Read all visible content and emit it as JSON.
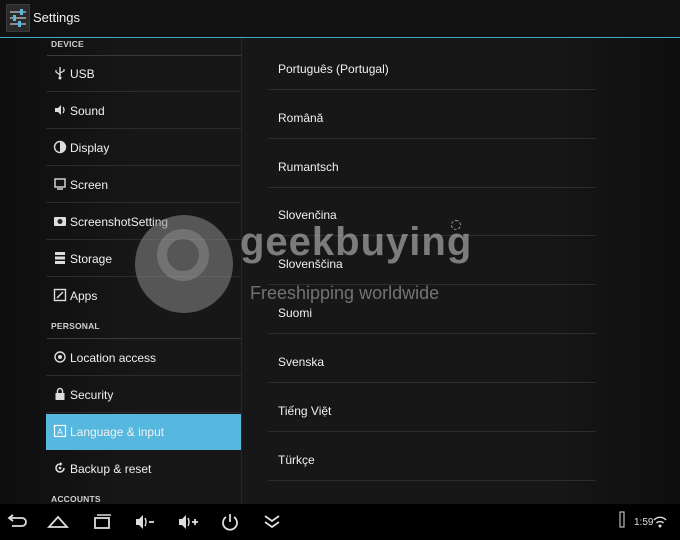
{
  "app": {
    "title": "Settings",
    "icon": "settings-sliders-icon"
  },
  "left": {
    "sections": {
      "device": "DEVICE",
      "personal": "PERSONAL",
      "accounts": "ACCOUNTS"
    },
    "items": [
      {
        "label": "USB",
        "icon": "usb-icon"
      },
      {
        "label": "Sound",
        "icon": "speaker-icon"
      },
      {
        "label": "Display",
        "icon": "brightness-icon"
      },
      {
        "label": "Screen",
        "icon": "screen-icon"
      },
      {
        "label": "ScreenshotSetting",
        "icon": "camera-icon"
      },
      {
        "label": "Storage",
        "icon": "storage-icon"
      },
      {
        "label": "Apps",
        "icon": "apps-icon"
      },
      {
        "label": "Location access",
        "icon": "location-icon"
      },
      {
        "label": "Security",
        "icon": "lock-icon"
      },
      {
        "label": "Language & input",
        "icon": "language-icon",
        "selected": true
      },
      {
        "label": "Backup & reset",
        "icon": "backup-icon"
      }
    ]
  },
  "languages": [
    "Português (Portugal)",
    "Română",
    "Rumantsch",
    "Slovenčina",
    "Slovenščina",
    "Suomi",
    "Svenska",
    "Tiếng Việt",
    "Türkçe"
  ],
  "watermark": {
    "brand": "geekbuying",
    "tagline": "Freeshipping worldwide"
  },
  "navbar": {
    "buttons": [
      "back-icon",
      "home-icon",
      "recent-apps-icon",
      "volume-down-icon",
      "volume-up-icon",
      "power-icon",
      "hide-bar-icon"
    ]
  },
  "status": {
    "time": "1:59",
    "icons": [
      "usb-status-icon",
      "wifi-icon"
    ]
  },
  "colors": {
    "accent": "#56b8df",
    "actionbar_line": "#4aa7c8",
    "background": "#171717"
  }
}
